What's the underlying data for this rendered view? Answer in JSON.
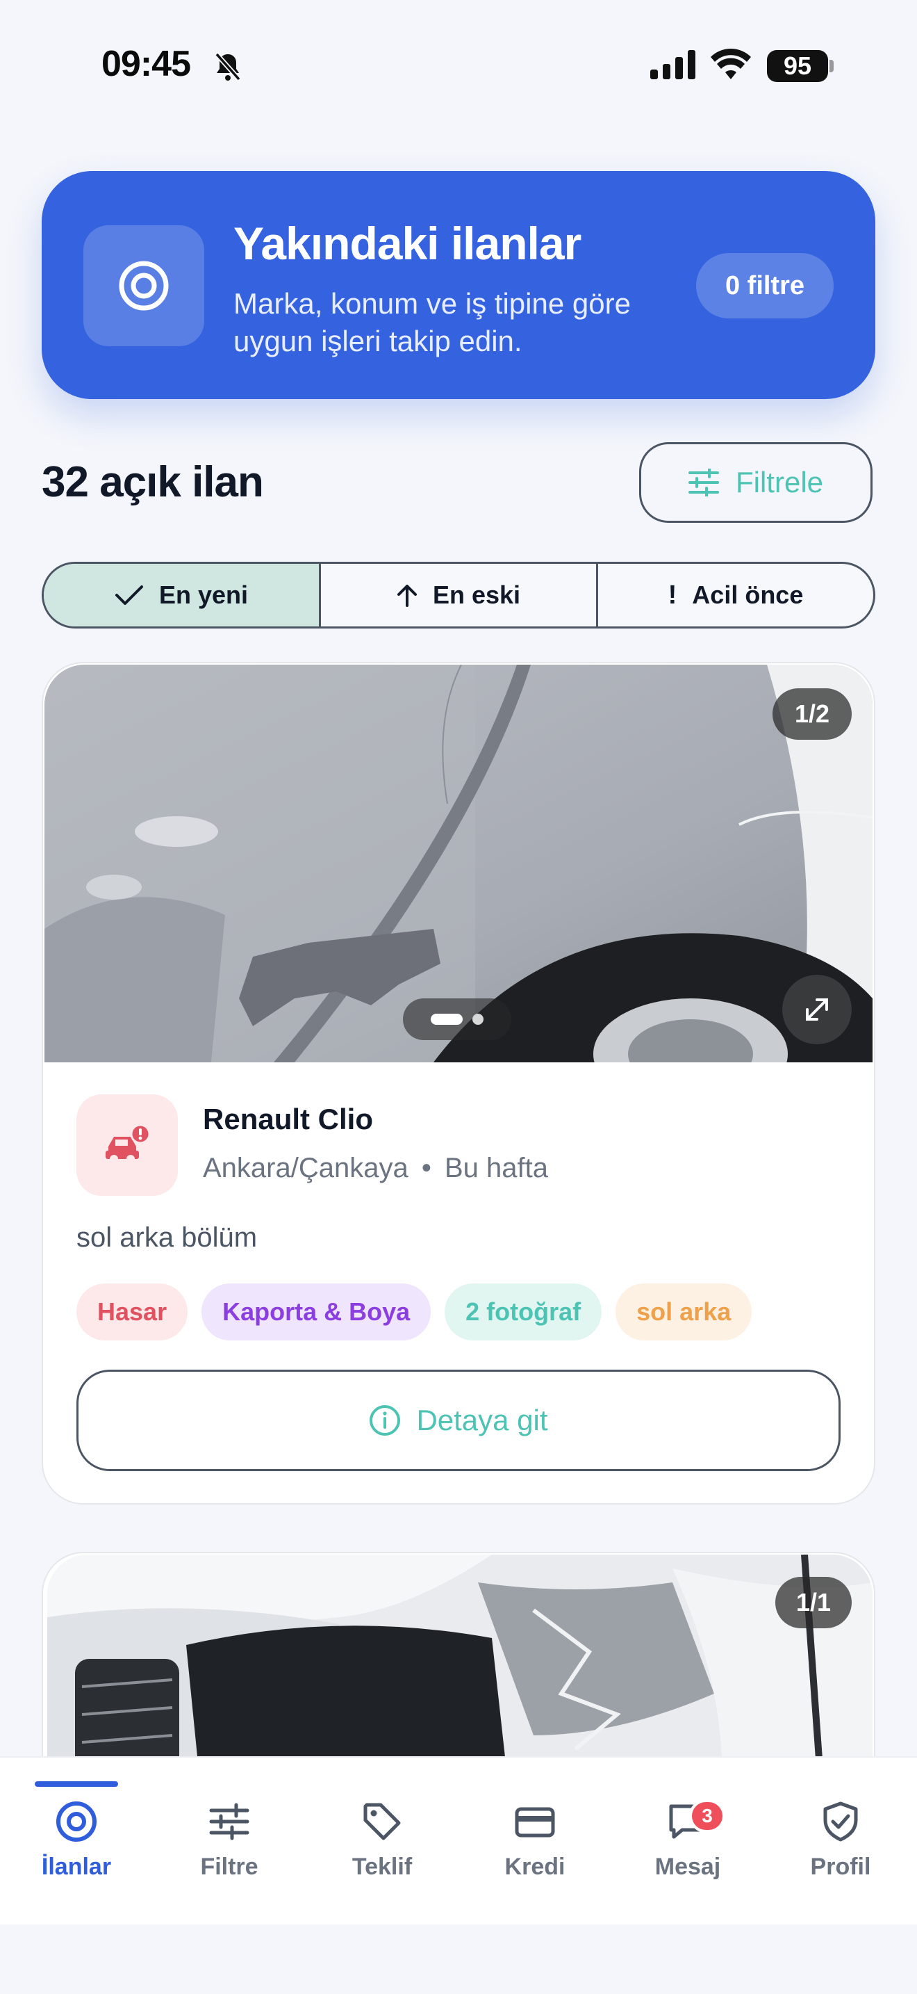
{
  "status_bar": {
    "time": "09:45",
    "battery": "95"
  },
  "banner": {
    "title": "Yakındaki ilanlar",
    "subtitle": "Marka, konum ve iş tipine göre uygun işleri takip edin.",
    "filter_count": "0 filtre",
    "icon": "at-target-icon"
  },
  "listing_header": {
    "count": "32 açık ilan",
    "filter_button": "Filtrele"
  },
  "sort": {
    "options": [
      {
        "label": "En yeni",
        "icon": "check-icon",
        "active": true
      },
      {
        "label": "En eski",
        "icon": "arrow-up-icon",
        "active": false
      },
      {
        "label": "Acil önce",
        "icon": "exclamation-icon",
        "active": false
      }
    ]
  },
  "cards": [
    {
      "photo_counter": "1/2",
      "title": "Renault Clio",
      "location": "Ankara/Çankaya",
      "separator": "•",
      "time": "Bu hafta",
      "description": "sol arka bölüm",
      "tags": [
        "Hasar",
        "Kaporta & Boya",
        "2 fotoğraf",
        "sol arka"
      ],
      "action": "Detaya git"
    },
    {
      "photo_counter": "1/1"
    }
  ],
  "tabbar": {
    "items": [
      {
        "label": "İlanlar",
        "icon": "at-icon",
        "active": true
      },
      {
        "label": "Filtre",
        "icon": "sliders-icon",
        "active": false
      },
      {
        "label": "Teklif",
        "icon": "tag-icon",
        "active": false
      },
      {
        "label": "Kredi",
        "icon": "credit-card-icon",
        "active": false
      },
      {
        "label": "Mesaj",
        "icon": "message-icon",
        "active": false,
        "badge": "3"
      },
      {
        "label": "Profil",
        "icon": "shield-check-icon",
        "active": false
      }
    ]
  },
  "colors": {
    "primary": "#3563e0",
    "accent": "#4cc3b3",
    "danger": "#e05260"
  }
}
